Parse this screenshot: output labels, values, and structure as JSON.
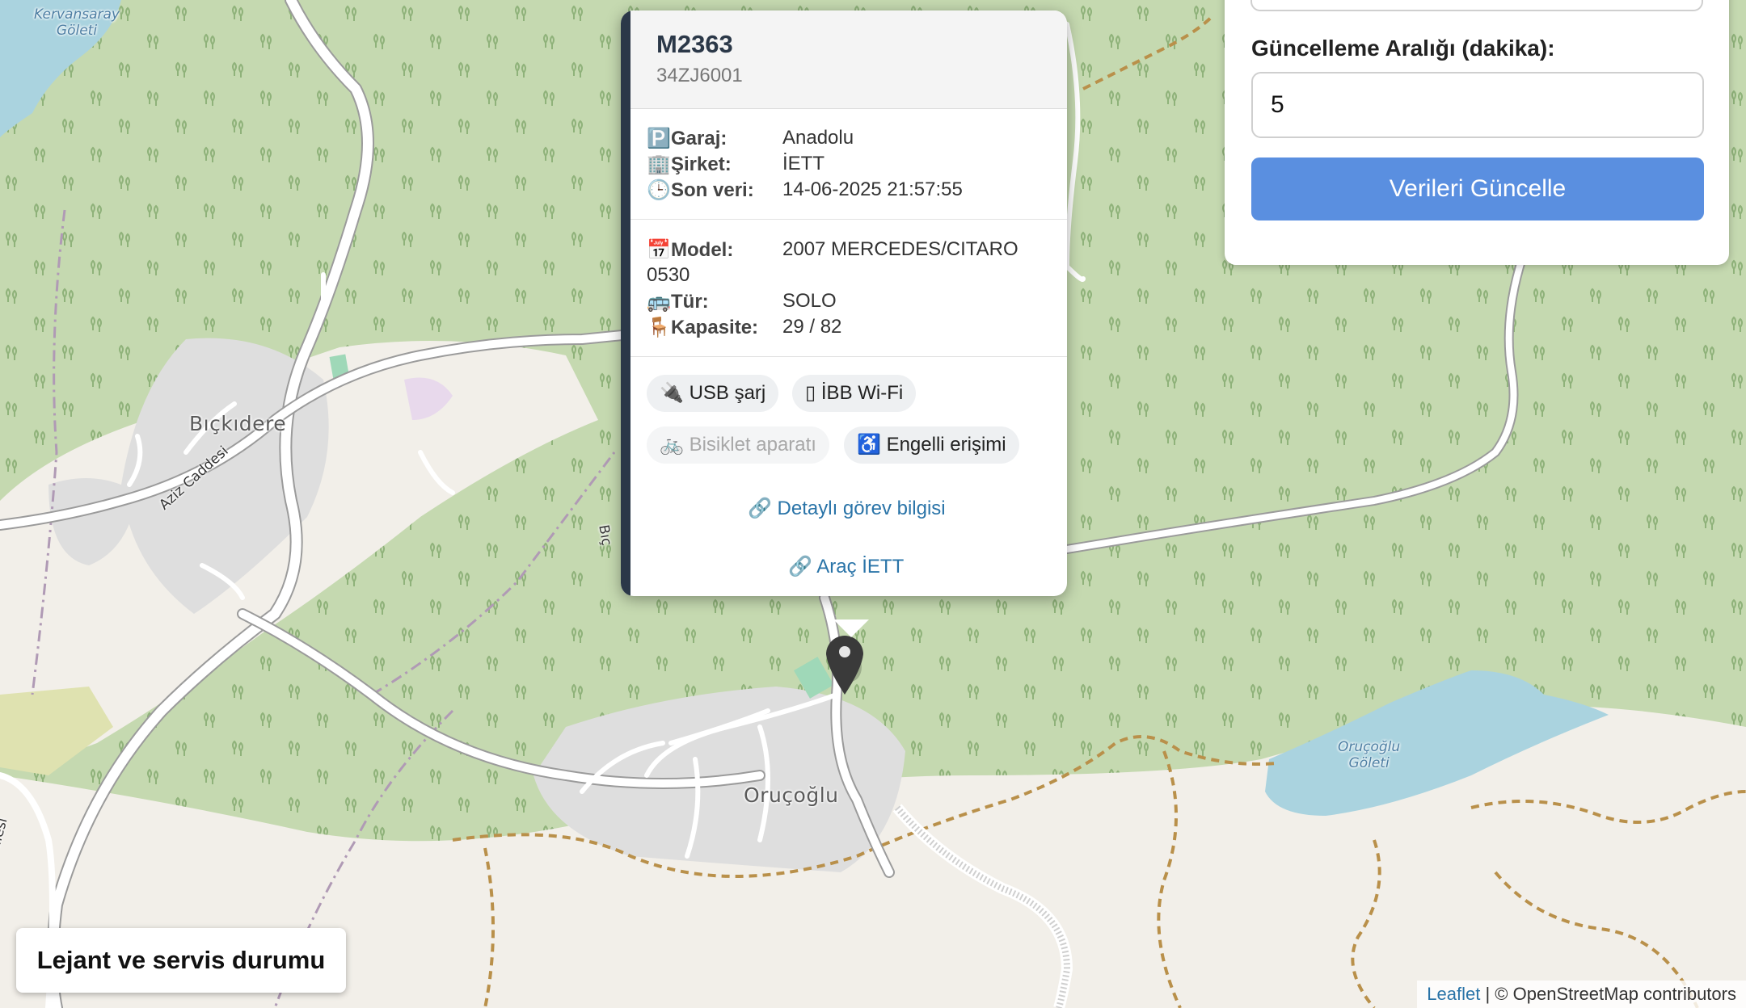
{
  "map": {
    "place_labels": [
      "Bıçkıdere",
      "Oruçoğlu"
    ],
    "water_labels": [
      {
        "line1": "Kervansaray",
        "line2": "Göleti"
      },
      {
        "line1": "Oruçoğlu",
        "line2": "Göleti"
      }
    ],
    "street_labels": [
      "Aziz Caddesi",
      "Bıç"
    ],
    "partial_labels": [
      "illesi"
    ],
    "colors": {
      "forest": "#c5d9b0",
      "land": "#f2efe9",
      "urban": "#dedede",
      "water": "#aad3df",
      "road": "#ffffff",
      "track": "#b9904a"
    }
  },
  "popup": {
    "title": "M2363",
    "plate": "34ZJ6001",
    "rows_top": [
      {
        "icon": "🅿️",
        "label": "Garaj:",
        "value": "Anadolu"
      },
      {
        "icon": "🏢",
        "label": "Şirket:",
        "value": "İETT"
      },
      {
        "icon": "🕒",
        "label": "Son veri:",
        "value": "14-06-2025 21:57:55"
      }
    ],
    "model": {
      "icon": "📅",
      "label": "Model:",
      "value_line1": "2007 MERCEDES/CITARO",
      "value_line2": "0530"
    },
    "type": {
      "icon": "🚌",
      "label": "Tür:",
      "value": "SOLO"
    },
    "capacity": {
      "icon": "🪑",
      "label": "Kapasite:",
      "value": "29 / 82"
    },
    "features": [
      {
        "icon": "🔌",
        "label": "USB şarj",
        "enabled": true
      },
      {
        "icon": "▯",
        "label": "İBB Wi-Fi",
        "enabled": true
      },
      {
        "icon": "🚲",
        "label": "Bisiklet aparatı",
        "enabled": false
      },
      {
        "icon": "♿",
        "label": "Engelli erişimi",
        "enabled": true
      }
    ],
    "link_detail": "🔗 Detaylı görev bilgisi",
    "link_vehicle": "🔗 Araç İETT"
  },
  "panel": {
    "interval_label": "Güncelleme Aralığı (dakika):",
    "interval_value": "5",
    "update_button": "Verileri Güncelle"
  },
  "legend": {
    "label": "Lejant ve servis durumu"
  },
  "attribution": {
    "link": "Leaflet",
    "text": " | © OpenStreetMap contributors"
  }
}
